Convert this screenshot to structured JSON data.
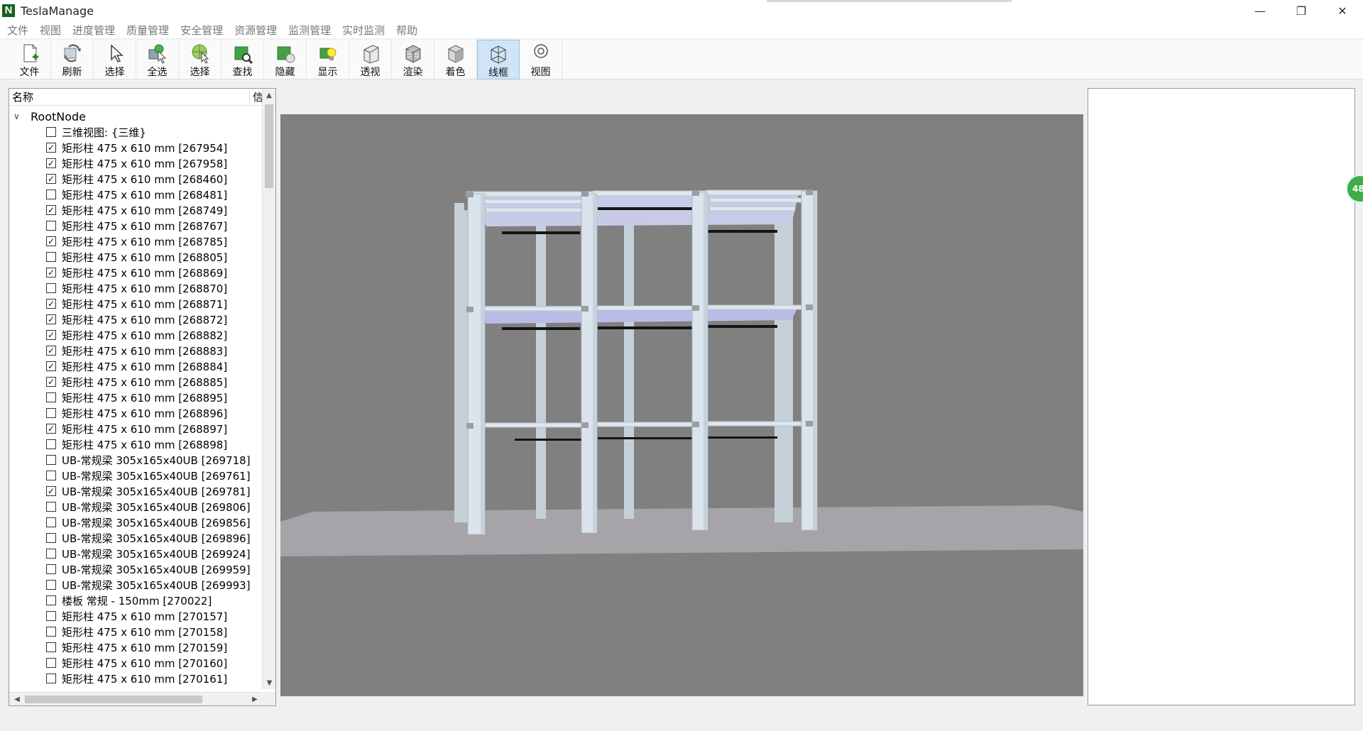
{
  "app": {
    "logo_letter": "N",
    "title": "TeslaManage"
  },
  "window_controls": {
    "minimize": "—",
    "restore": "❐",
    "close": "✕"
  },
  "menu": [
    "文件",
    "视图",
    "进度管理",
    "质量管理",
    "安全管理",
    "资源管理",
    "监测管理",
    "实时监测",
    "帮助"
  ],
  "toolbar": [
    {
      "label": "文件",
      "icon": "new-file-icon"
    },
    {
      "label": "刷新",
      "icon": "refresh-icon"
    },
    {
      "label": "选择",
      "icon": "pointer-icon"
    },
    {
      "label": "全选",
      "icon": "select-all-icon"
    },
    {
      "label": "选择",
      "icon": "select-globe-icon"
    },
    {
      "label": "查找",
      "icon": "find-icon"
    },
    {
      "label": "隐藏",
      "icon": "hide-icon"
    },
    {
      "label": "显示",
      "icon": "show-bulb-icon"
    },
    {
      "label": "透视",
      "icon": "perspective-icon"
    },
    {
      "label": "渲染",
      "icon": "render-icon"
    },
    {
      "label": "着色",
      "icon": "shade-cube-icon"
    },
    {
      "label": "线框",
      "icon": "wireframe-cube-icon",
      "active": true
    },
    {
      "label": "视图",
      "icon": "view-icon"
    }
  ],
  "tree": {
    "header_name": "名称",
    "header_info": "信",
    "root_label": "RootNode",
    "items": [
      {
        "label": "三维视图: {三维}",
        "checked": false
      },
      {
        "label": "矩形柱 475 x 610 mm [267954]",
        "checked": true
      },
      {
        "label": "矩形柱 475 x 610 mm [267958]",
        "checked": true
      },
      {
        "label": "矩形柱 475 x 610 mm [268460]",
        "checked": true
      },
      {
        "label": "矩形柱 475 x 610 mm [268481]",
        "checked": false
      },
      {
        "label": "矩形柱 475 x 610 mm [268749]",
        "checked": true
      },
      {
        "label": "矩形柱 475 x 610 mm [268767]",
        "checked": false
      },
      {
        "label": "矩形柱 475 x 610 mm [268785]",
        "checked": true
      },
      {
        "label": "矩形柱 475 x 610 mm [268805]",
        "checked": false
      },
      {
        "label": "矩形柱 475 x 610 mm [268869]",
        "checked": true
      },
      {
        "label": "矩形柱 475 x 610 mm [268870]",
        "checked": false
      },
      {
        "label": "矩形柱 475 x 610 mm [268871]",
        "checked": true
      },
      {
        "label": "矩形柱 475 x 610 mm [268872]",
        "checked": true
      },
      {
        "label": "矩形柱 475 x 610 mm [268882]",
        "checked": true
      },
      {
        "label": "矩形柱 475 x 610 mm [268883]",
        "checked": true
      },
      {
        "label": "矩形柱 475 x 610 mm [268884]",
        "checked": true
      },
      {
        "label": "矩形柱 475 x 610 mm [268885]",
        "checked": true
      },
      {
        "label": "矩形柱 475 x 610 mm [268895]",
        "checked": false
      },
      {
        "label": "矩形柱 475 x 610 mm [268896]",
        "checked": false
      },
      {
        "label": "矩形柱 475 x 610 mm [268897]",
        "checked": true
      },
      {
        "label": "矩形柱 475 x 610 mm [268898]",
        "checked": false
      },
      {
        "label": "UB-常规梁 305x165x40UB [269718]",
        "checked": false
      },
      {
        "label": "UB-常规梁 305x165x40UB [269761]",
        "checked": false
      },
      {
        "label": "UB-常规梁 305x165x40UB [269781]",
        "checked": true
      },
      {
        "label": "UB-常规梁 305x165x40UB [269806]",
        "checked": false
      },
      {
        "label": "UB-常规梁 305x165x40UB [269856]",
        "checked": false
      },
      {
        "label": "UB-常规梁 305x165x40UB [269896]",
        "checked": false
      },
      {
        "label": "UB-常规梁 305x165x40UB [269924]",
        "checked": false
      },
      {
        "label": "UB-常规梁 305x165x40UB [269959]",
        "checked": false
      },
      {
        "label": "UB-常规梁 305x165x40UB [269993]",
        "checked": false
      },
      {
        "label": "楼板 常规 - 150mm [270022]",
        "checked": false
      },
      {
        "label": "矩形柱 475 x 610 mm [270157]",
        "checked": false
      },
      {
        "label": "矩形柱 475 x 610 mm [270158]",
        "checked": false
      },
      {
        "label": "矩形柱 475 x 610 mm [270159]",
        "checked": false
      },
      {
        "label": "矩形柱 475 x 610 mm [270160]",
        "checked": false
      },
      {
        "label": "矩形柱 475 x 610 mm [270161]",
        "checked": false
      }
    ]
  },
  "badge": {
    "text": "48"
  },
  "colors": {
    "viewport_bg": "#808080",
    "ground": "#a7a4a9",
    "member": "#d8e2ea",
    "beam_shadow": "#1a1a1a",
    "active_tool": "#cfe4f7"
  }
}
